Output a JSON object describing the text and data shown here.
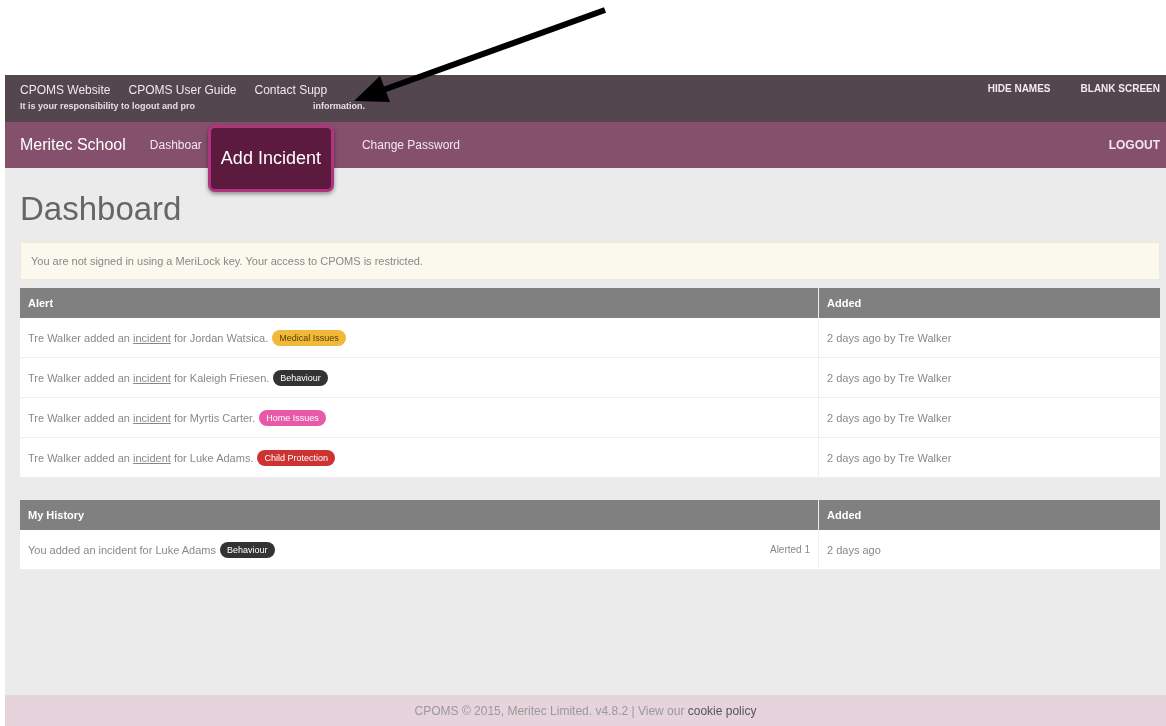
{
  "top_bar": {
    "links": [
      "CPOMS Website",
      "CPOMS User Guide",
      "Contact Supp"
    ],
    "notice_start": "It is your responsibility to logout and pro",
    "notice_end": "information.",
    "actions": [
      "HIDE NAMES",
      "BLANK SCREEN"
    ]
  },
  "nav": {
    "brand": "Meritec School",
    "items": [
      {
        "label": "Dashboar",
        "selected": false
      },
      {
        "label": "Add Incident",
        "selected": true
      },
      {
        "label": "Change Password",
        "selected": false
      }
    ],
    "logout": "LOGOUT"
  },
  "page_title": "Dashboard",
  "warning": "You are not signed in using a MeriLock key. Your access to CPOMS is restricted.",
  "alerts": {
    "columns": [
      "Alert",
      "Added"
    ],
    "rows": [
      {
        "before": "Tre Walker added an ",
        "link": "incident",
        "after": " for Jordan Watsica.",
        "tag": "Medical Issues",
        "color": "#f0b93a",
        "added": "2 days ago by Tre Walker"
      },
      {
        "before": "Tre Walker added an ",
        "link": "incident",
        "after": " for Kaleigh Friesen.",
        "tag": "Behaviour",
        "color": "#333333",
        "added": "2 days ago by Tre Walker"
      },
      {
        "before": "Tre Walker added an ",
        "link": "incident",
        "after": " for Myrtis Carter.",
        "tag": "Home Issues",
        "color": "#e85aa8",
        "added": "2 days ago by Tre Walker"
      },
      {
        "before": "Tre Walker added an ",
        "link": "incident",
        "after": " for Luke Adams.",
        "tag": "Child Protection",
        "color": "#cc3333",
        "added": "2 days ago by Tre Walker"
      }
    ]
  },
  "history": {
    "columns": [
      "My History",
      "Added"
    ],
    "rows": [
      {
        "text": "You added an incident for Luke Adams",
        "tag": "Behaviour",
        "color": "#333333",
        "alerted": "Alerted 1",
        "added": "2 days ago"
      }
    ]
  },
  "footer": {
    "text": "CPOMS © 2015, Meritec Limited. v4.8.2 | View our ",
    "link": "cookie policy"
  }
}
